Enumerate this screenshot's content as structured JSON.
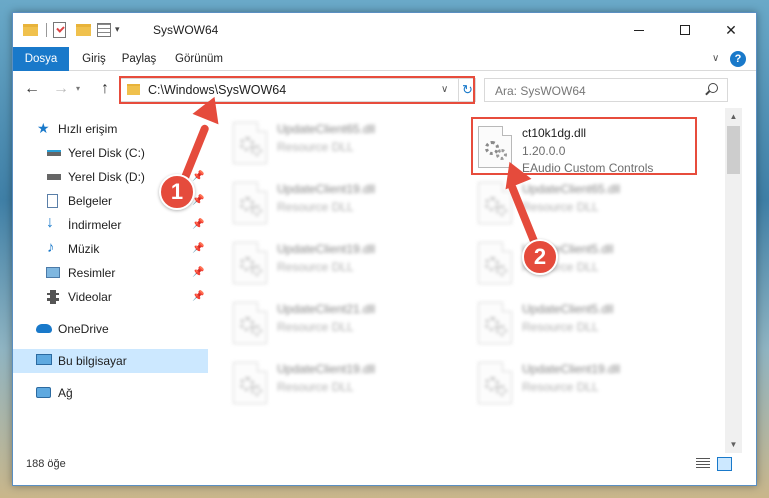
{
  "window": {
    "title": "SysWOW64"
  },
  "ribbon": {
    "tabs": [
      "Dosya",
      "Giriş",
      "Paylaş",
      "Görünüm"
    ]
  },
  "navbar": {
    "address": "C:\\Windows\\SysWOW64",
    "search_placeholder": "Ara: SysWOW64"
  },
  "sidebar": {
    "items": [
      {
        "label": "Hızlı erişim",
        "icon": "star-icon"
      },
      {
        "label": "Yerel Disk (C:)",
        "icon": "drive-icon"
      },
      {
        "label": "Yerel Disk (D:)",
        "icon": "drive-icon"
      },
      {
        "label": "Belgeler",
        "icon": "document-icon"
      },
      {
        "label": "İndirmeler",
        "icon": "download-icon"
      },
      {
        "label": "Müzik",
        "icon": "music-icon"
      },
      {
        "label": "Resimler",
        "icon": "picture-icon"
      },
      {
        "label": "Videolar",
        "icon": "video-icon"
      },
      {
        "label": "OneDrive",
        "icon": "cloud-icon"
      },
      {
        "label": "Bu bilgisayar",
        "icon": "computer-icon"
      },
      {
        "label": "Ağ",
        "icon": "network-icon"
      }
    ]
  },
  "files": {
    "highlighted": {
      "name": "ct10k1dg.dll",
      "version": "1.20.0.0",
      "description": "EAudio Custom Controls"
    },
    "left_column": [
      {
        "name": "UpdateClient65.dll",
        "type": "Resource DLL"
      },
      {
        "name": "UpdateClient19.dll",
        "type": "Resource DLL"
      },
      {
        "name": "UpdateClient19.dll",
        "type": "Resource DLL"
      },
      {
        "name": "UpdateClient21.dll",
        "type": "Resource DLL"
      },
      {
        "name": "UpdateClient19.dll",
        "type": "Resource DLL"
      }
    ],
    "right_column": [
      {
        "name": "UpdateClient65.dll",
        "type": "Resource DLL"
      },
      {
        "name": "UpdateClient5.dll",
        "type": "Resource DLL"
      },
      {
        "name": "UpdateClient5.dll",
        "type": "Resource DLL"
      },
      {
        "name": "UpdateClient19.dll",
        "type": "Resource DLL"
      }
    ]
  },
  "status": {
    "item_count": "188 öğe"
  },
  "annotations": {
    "badge1": "1",
    "badge2": "2"
  },
  "colors": {
    "accent": "#1979ca",
    "highlight": "#e74c3c",
    "selected": "#cce8ff"
  }
}
